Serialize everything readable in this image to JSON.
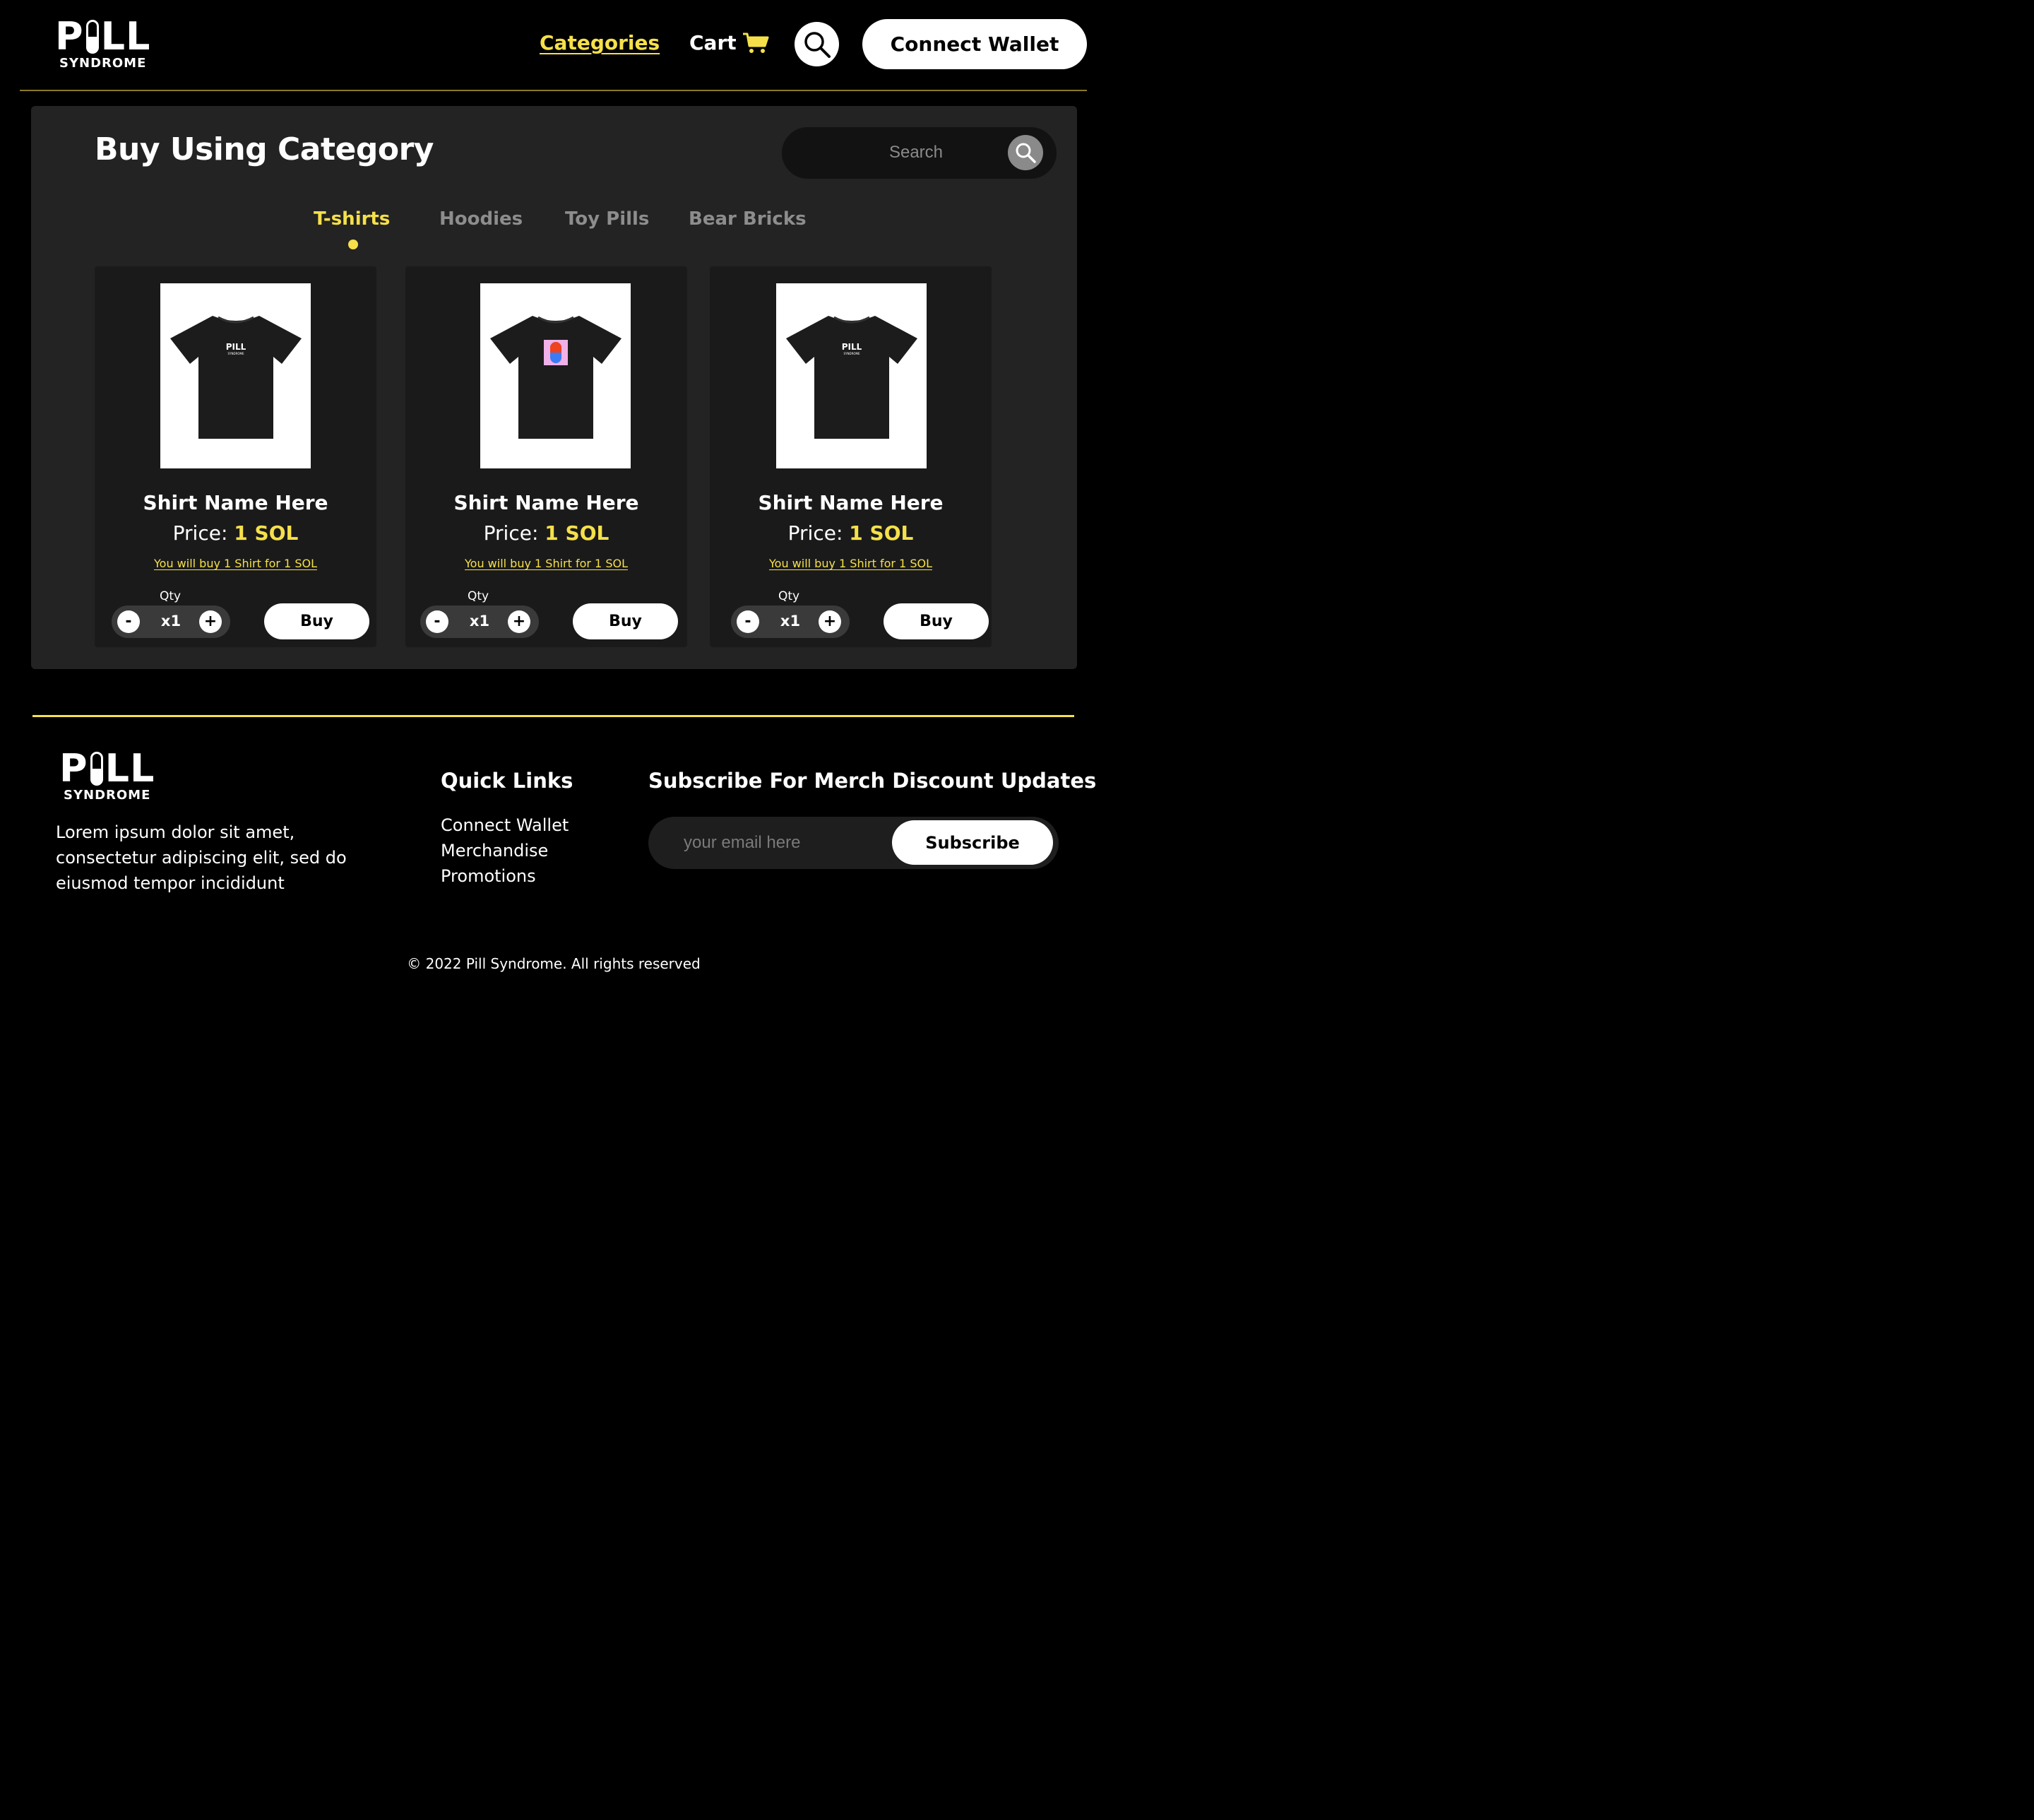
{
  "brand": {
    "logo_word_left": "P",
    "logo_word_right": "LL",
    "logo_sub": "SYNDROME"
  },
  "header": {
    "nav_categories": "Categories",
    "nav_cart": "Cart",
    "connect_wallet": "Connect Wallet",
    "icons": [
      "cart-icon",
      "search-icon"
    ]
  },
  "colors": {
    "accent": "#f5e04a",
    "background": "#000000",
    "panel": "#232323",
    "card": "#1a1a1a"
  },
  "main": {
    "title": "Buy Using Category",
    "search_placeholder": "Search",
    "tabs": [
      {
        "label": "T-shirts",
        "active": true
      },
      {
        "label": "Hoodies",
        "active": false
      },
      {
        "label": "Toy Pills",
        "active": false
      },
      {
        "label": "Bear Bricks",
        "active": false
      }
    ],
    "products": [
      {
        "name": "Shirt Name Here",
        "price_label": "Price:",
        "price_value": "1 SOL",
        "note": "You will buy 1 Shirt for 1 SOL",
        "qty_label": "Qty",
        "qty": "x1",
        "buy": "Buy",
        "print": "pill-logo"
      },
      {
        "name": "Shirt Name Here",
        "price_label": "Price:",
        "price_value": "1 SOL",
        "note": "You will buy 1 Shirt for 1 SOL",
        "qty_label": "Qty",
        "qty": "x1",
        "buy": "Buy",
        "print": "red-blue-capsule"
      },
      {
        "name": "Shirt Name Here",
        "price_label": "Price:",
        "price_value": "1 SOL",
        "note": "You will buy 1 Shirt for 1 SOL",
        "qty_label": "Qty",
        "qty": "x1",
        "buy": "Buy",
        "print": "pill-logo"
      }
    ],
    "stepper": {
      "minus": "-",
      "plus": "+"
    }
  },
  "footer": {
    "description": "Lorem ipsum dolor sit amet, consectetur adipiscing elit, sed do eiusmod tempor incididunt",
    "quick_links_title": "Quick Links",
    "quick_links": [
      "Connect Wallet",
      "Merchandise",
      "Promotions"
    ],
    "subscribe_title": "Subscribe For Merch Discount Updates",
    "email_placeholder": "your email here",
    "subscribe_button": "Subscribe",
    "copyright": "© 2022 Pill Syndrome. All rights reserved"
  }
}
